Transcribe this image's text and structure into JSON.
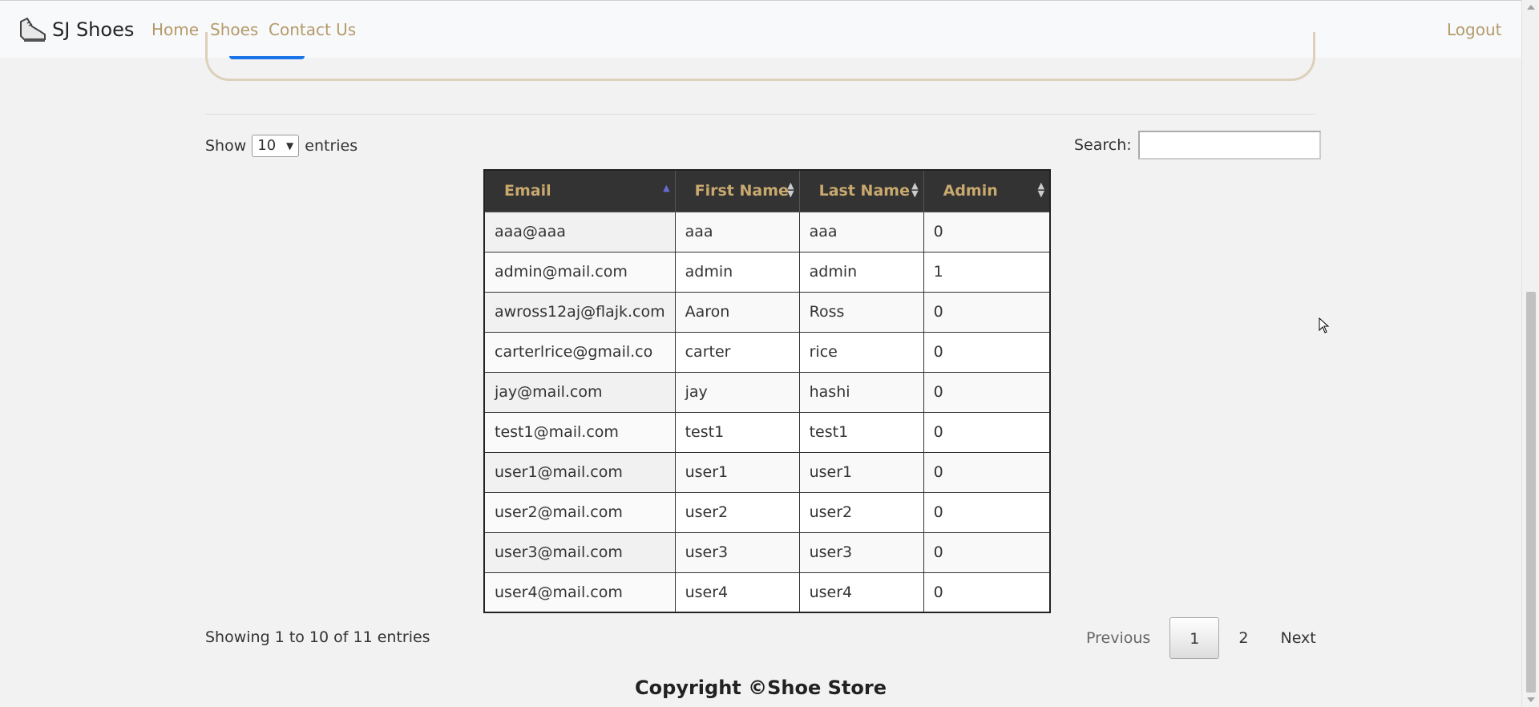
{
  "navbar": {
    "brand": "SJ Shoes",
    "brand_icon": "shoe-icon",
    "links": [
      "Home",
      "Shoes",
      "Contact Us"
    ],
    "logout": "Logout"
  },
  "colors": {
    "accent": "#b49a6b",
    "header_bg": "#333333",
    "header_text": "#c9a96e",
    "page_bg": "#f2f2f2"
  },
  "controls": {
    "show_label": "Show",
    "entries_label": "entries",
    "page_length": "10",
    "search_label": "Search:",
    "search_value": ""
  },
  "table": {
    "columns": [
      "Email",
      "First Name",
      "Last Name",
      "Admin"
    ],
    "sorted_column": "Email",
    "sort_direction": "asc",
    "rows": [
      [
        "aaa@aaa",
        "aaa",
        "aaa",
        "0"
      ],
      [
        "admin@mail.com",
        "admin",
        "admin",
        "1"
      ],
      [
        "awross12aj@flajk.com",
        "Aaron",
        "Ross",
        "0"
      ],
      [
        "carterlrice@gmail.co",
        "carter",
        "rice",
        "0"
      ],
      [
        "jay@mail.com",
        "jay",
        "hashi",
        "0"
      ],
      [
        "test1@mail.com",
        "test1",
        "test1",
        "0"
      ],
      [
        "user1@mail.com",
        "user1",
        "user1",
        "0"
      ],
      [
        "user2@mail.com",
        "user2",
        "user2",
        "0"
      ],
      [
        "user3@mail.com",
        "user3",
        "user3",
        "0"
      ],
      [
        "user4@mail.com",
        "user4",
        "user4",
        "0"
      ]
    ]
  },
  "pagination": {
    "info": "Showing 1 to 10 of 11 entries",
    "previous": "Previous",
    "pages": [
      "1",
      "2"
    ],
    "current_page": "1",
    "next": "Next"
  },
  "footer": {
    "copyright": "Copyright ©Shoe Store"
  }
}
